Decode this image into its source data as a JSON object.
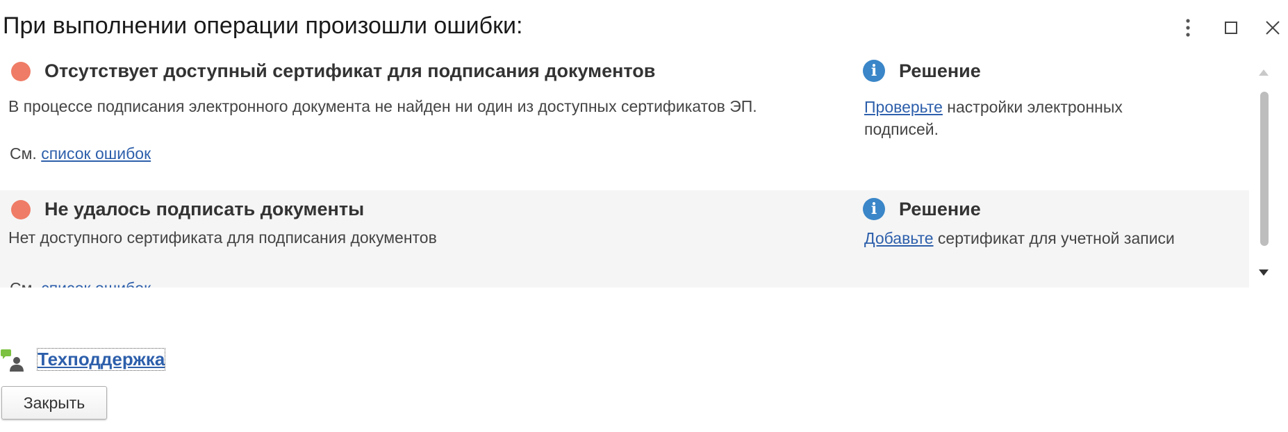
{
  "window": {
    "title": "При выполнении операции произошли ошибки:",
    "icons": [
      "more-vertical-icon",
      "maximize-icon",
      "close-icon"
    ]
  },
  "errors": [
    {
      "title": "Отсутствует доступный сертификат для подписания документов",
      "description": "В процессе подписания электронного документа не найден ни один из доступных сертификатов ЭП.",
      "see_prefix": "См.",
      "see_link": "список ошибок",
      "solution_title": "Решение",
      "solution_link": "Проверьте",
      "solution_text": " настройки электронных подписей."
    },
    {
      "title": "Не удалось подписать документы",
      "description": "Нет доступного сертификата для подписания документов",
      "see_prefix": "См.",
      "see_link": "список ошибок",
      "solution_title": "Решение",
      "solution_link": "Добавьте",
      "solution_text": " сертификат для учетной записи"
    }
  ],
  "support": {
    "label": "Техподдержка",
    "icon": "support-chat-icon"
  },
  "buttons": {
    "close_label": "Закрыть"
  },
  "colors": {
    "error_dot": "#ef7c66",
    "info": "#3a86c8",
    "link": "#2d5fab",
    "row_alt_bg": "#f5f5f5"
  }
}
